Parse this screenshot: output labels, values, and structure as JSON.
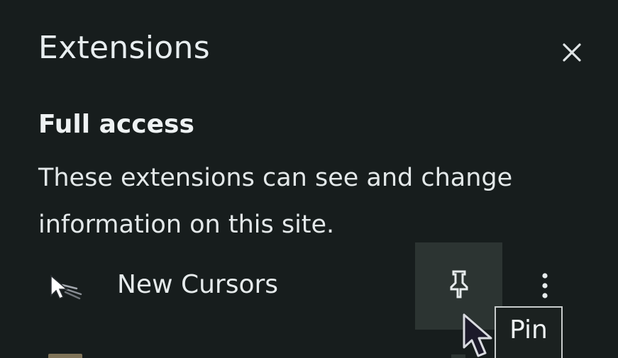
{
  "panel": {
    "title": "Extensions",
    "close_icon": "close-icon"
  },
  "section": {
    "title": "Full access",
    "description": "These extensions can see and change information on this site."
  },
  "extensions": [
    {
      "name": "New Cursors",
      "icon": "cursor-extension-icon",
      "pin_icon": "pin-icon",
      "more_icon": "more-vertical-icon"
    }
  ],
  "tooltip": {
    "text": "Pin"
  },
  "colors": {
    "background": "#171d1d",
    "pin_hover": "#2c3432",
    "text": "#e6ebec",
    "tooltip_border": "#c8cccc"
  }
}
